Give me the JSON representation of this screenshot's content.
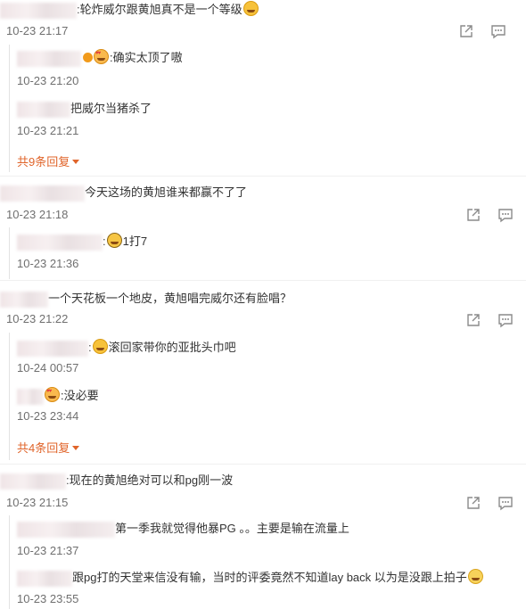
{
  "comments": [
    {
      "text": ":轮炸威尔跟黄旭真不是一个等级",
      "time": "10-23 21:17",
      "replies": [
        {
          "text": ":确实太顶了嗷",
          "time": "10-23 21:20"
        },
        {
          "text": "把威尔当猪杀了",
          "time": "10-23 21:21"
        }
      ],
      "more": "共9条回复"
    },
    {
      "text": "今天这场的黄旭谁来都赢不了了",
      "time": "10-23 21:18",
      "replies": [
        {
          "text": "1打7",
          "time": "10-23 21:36"
        }
      ]
    },
    {
      "text": "一个天花板一个地皮，黄旭唱完威尔还有脸唱？",
      "time": "10-23 21:22",
      "replies": [
        {
          "text": "滚回家带你的亚批头巾吧",
          "time": "10-24 00:57"
        },
        {
          "text": ":没必要",
          "time": "10-23 23:44"
        }
      ],
      "more": "共4条回复"
    },
    {
      "text": ":现在的黄旭绝对可以和pg刚一波",
      "time": "10-23 21:15",
      "replies": [
        {
          "text": "第一季我就觉得他暴PG 。。主要是输在流量上",
          "time": "10-23 21:37"
        },
        {
          "text": "跟pg打的天堂来信没有输，当时的评委竟然不知道lay back 以为是没跟上拍子",
          "time": "10-23 23:55"
        }
      ]
    }
  ],
  "icons": {
    "share": "share-icon",
    "comment": "comment-icon",
    "emoji_laugh": "laughing-emoji-icon",
    "emoji_heart": "heart-eyes-emoji-icon",
    "emoji_grin": "grin-emoji-icon",
    "emoji_cry": "crying-emoji-icon",
    "emoji_smirk": "smirk-emoji-icon"
  },
  "colors": {
    "link_orange": "#e0642a",
    "time_gray": "#6f6f6f",
    "text": "#333333"
  }
}
